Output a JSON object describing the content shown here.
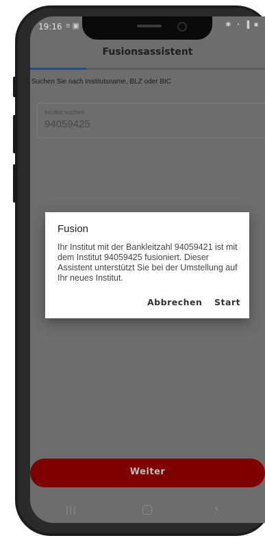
{
  "status_bar": {
    "time": "19:16",
    "left_icons": "≡ ▣",
    "right_icons": "✱ ◔ ▐ ■"
  },
  "app_bar": {
    "title": "Fusionsassistent"
  },
  "progress": {
    "fraction": 0.24,
    "color": "#1f4f86"
  },
  "search": {
    "hint": "Suchen Sie nach Institutsname, BLZ oder BIC",
    "label": "Institut suchen",
    "value": "94059425"
  },
  "dialog": {
    "title": "Fusion",
    "message": "Ihr Institut mit der Bankleitzahl 94059421 ist mit dem Institut 94059425 fusioniert. Dieser Assistent unterstützt Sie bei der Umstellung auf Ihr neues Institut.",
    "cancel_label": "Abbrechen",
    "start_label": "Start"
  },
  "footer": {
    "next_label": "Weiter",
    "accent": "#7e0000"
  },
  "nav_bar": {
    "recents_icon": "recents-icon",
    "recents_glyph": "|||",
    "home_icon": "home-icon",
    "back_icon": "back-icon",
    "back_glyph": "‹"
  }
}
